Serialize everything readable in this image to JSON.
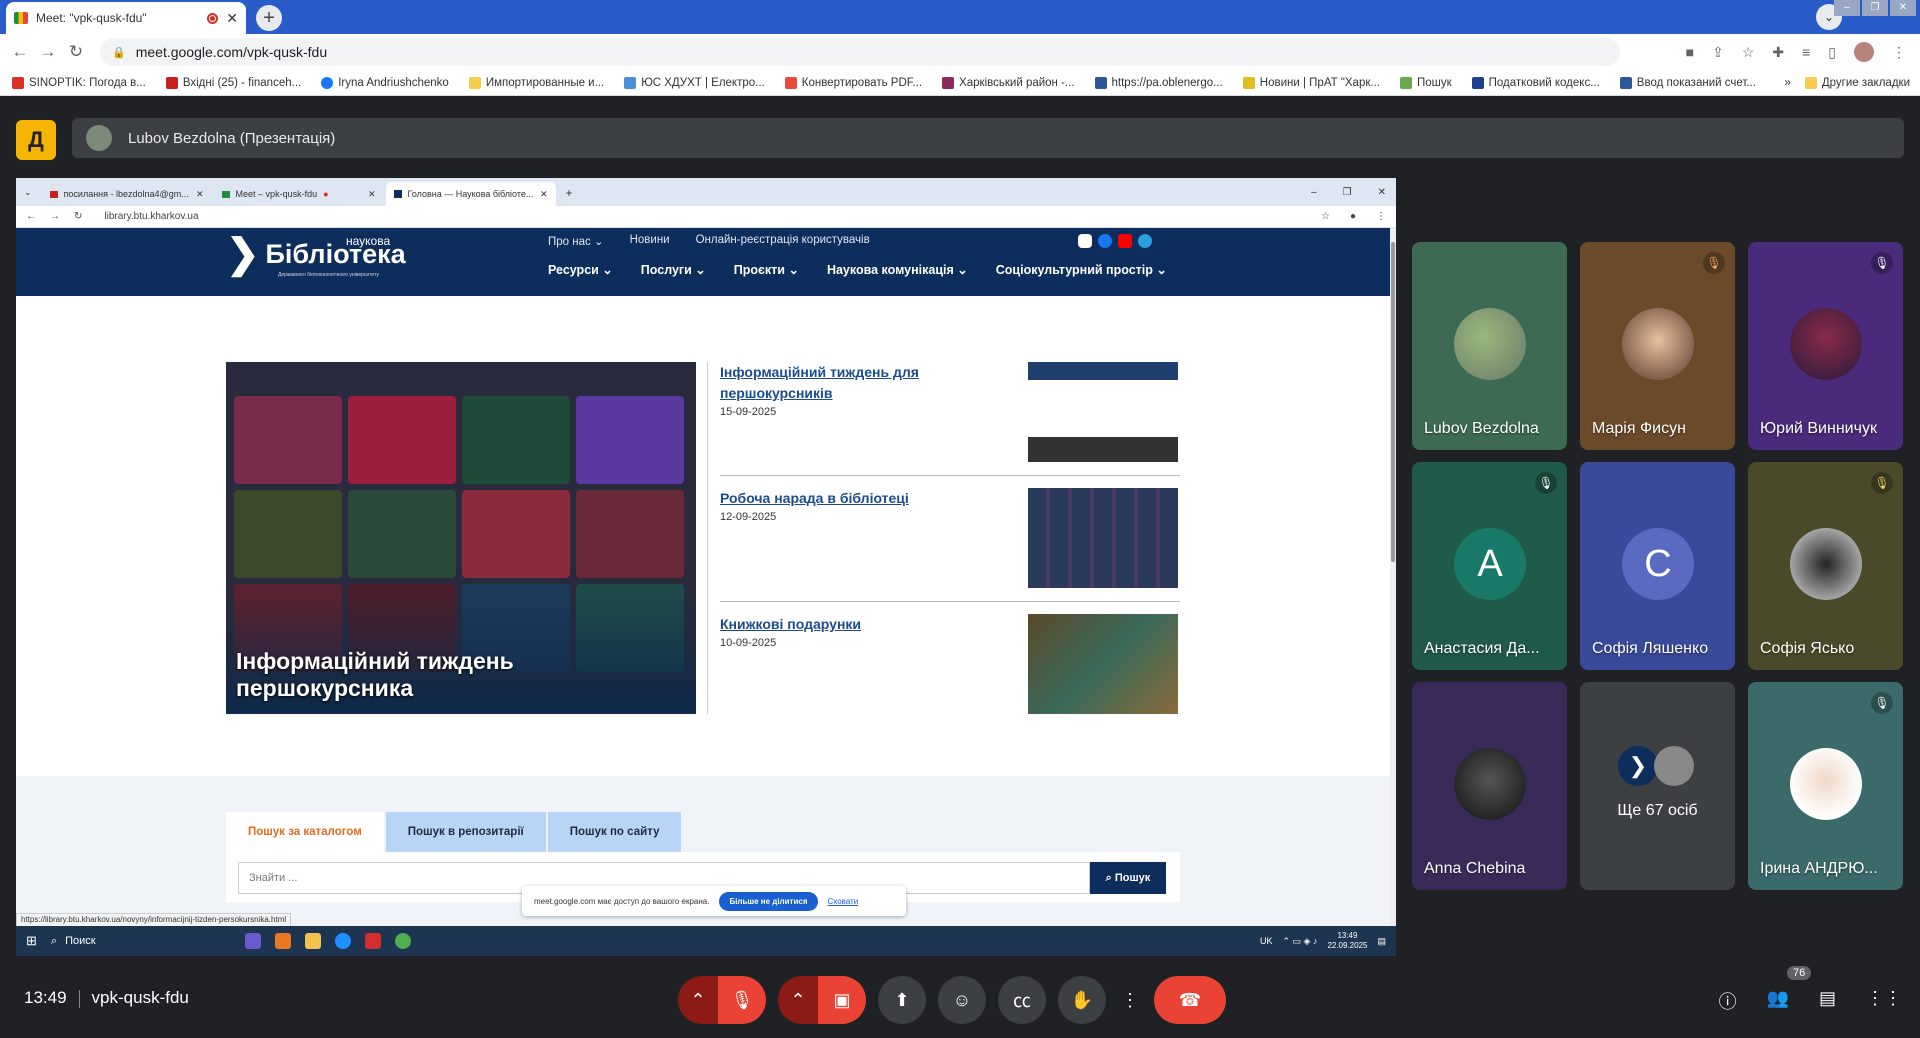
{
  "browser": {
    "tab_title": "Meet: \"vpk-qusk-fdu\"",
    "url": "meet.google.com/vpk-qusk-fdu",
    "bookmarks": [
      "SINOPTIK: Погода в...",
      "Вхідні (25) - financeh...",
      "Iryna Andriushchenko",
      "Импортированные и...",
      "ЮС ХДУХТ | Електро...",
      "Конвертировать PDF...",
      "Харківський район -...",
      "https://pa.oblenergo...",
      "Новини | ПрАТ \"Харк...",
      "Пошук",
      "Податковий кодекс...",
      "Ввод показаний счет..."
    ],
    "bookmarks_more": "»",
    "other_bookmarks": "Другие закладки"
  },
  "meet": {
    "presenter_label": "Lubov Bezdolna (Презентація)",
    "time": "13:49",
    "meeting_code": "vpk-qusk-fdu",
    "participants_count": "76",
    "tiles": [
      {
        "name": "Lubov Bezdolna",
        "muted": false
      },
      {
        "name": "Марія Фисун",
        "muted": true
      },
      {
        "name": "Юрий Винничук",
        "muted": true
      },
      {
        "name": "Анастасия Да...",
        "letter": "A",
        "muted": true
      },
      {
        "name": "Софія Ляшенко",
        "letter": "C",
        "muted": false
      },
      {
        "name": "Софія Ясько",
        "muted": true
      },
      {
        "name": "Anna Chebina",
        "muted": false
      },
      {
        "name": "Ще 67 осіб",
        "muted": false
      },
      {
        "name": "Ірина АНДРЮ...",
        "muted": true
      }
    ]
  },
  "shared": {
    "tabs": [
      "посилання - lbezdolna4@gm...",
      "Meet – vpk-qusk-fdu",
      "Головна — Наукова бібліоте..."
    ],
    "url": "library.btu.kharkov.ua",
    "logo_word": "Бібліотека",
    "logo_sup": "наукова",
    "logo_sub": "Державного біотехнологічного університету",
    "nav_top": [
      "Про нас ⌄",
      "Новини",
      "Онлайн-реєстрація користувачів"
    ],
    "nav_main": [
      "Ресурси ⌄",
      "Послуги ⌄",
      "Проєкти ⌄",
      "Наукова комунікація ⌄",
      "Соціокультурний простір ⌄"
    ],
    "feature_caption": "Інформаційний тиждень першокурсника",
    "news": [
      {
        "title": "Інформаційний тиждень для першокурсників",
        "date": "15-09-2025"
      },
      {
        "title": "Робоча нарада в бібліотеці",
        "date": "12-09-2025"
      },
      {
        "title": "Книжкові подарунки",
        "date": "10-09-2025"
      }
    ],
    "search_tabs": [
      "Пошук за каталогом",
      "Пошук в репозитарії",
      "Пошук по сайту"
    ],
    "search_placeholder": "Знайти ...",
    "search_button": "Пошук",
    "status_url": "https://library.btu.kharkov.ua/novyny/informacijnij-tizden-persokursnika.html",
    "share_notice": "meet.google.com має доступ до вашого екрана.",
    "stop_share": "Більше не ділитися",
    "hide": "Сховати",
    "taskbar_search": "Поиск",
    "tray_lang": "UK",
    "tray_time": "13:49",
    "tray_date": "22.09.2025"
  },
  "colors": {
    "lib_navy": "#0d2d5c",
    "meet_bg": "#202124",
    "end_call": "#ea4335",
    "chrome_blue": "#2a5cc9"
  }
}
